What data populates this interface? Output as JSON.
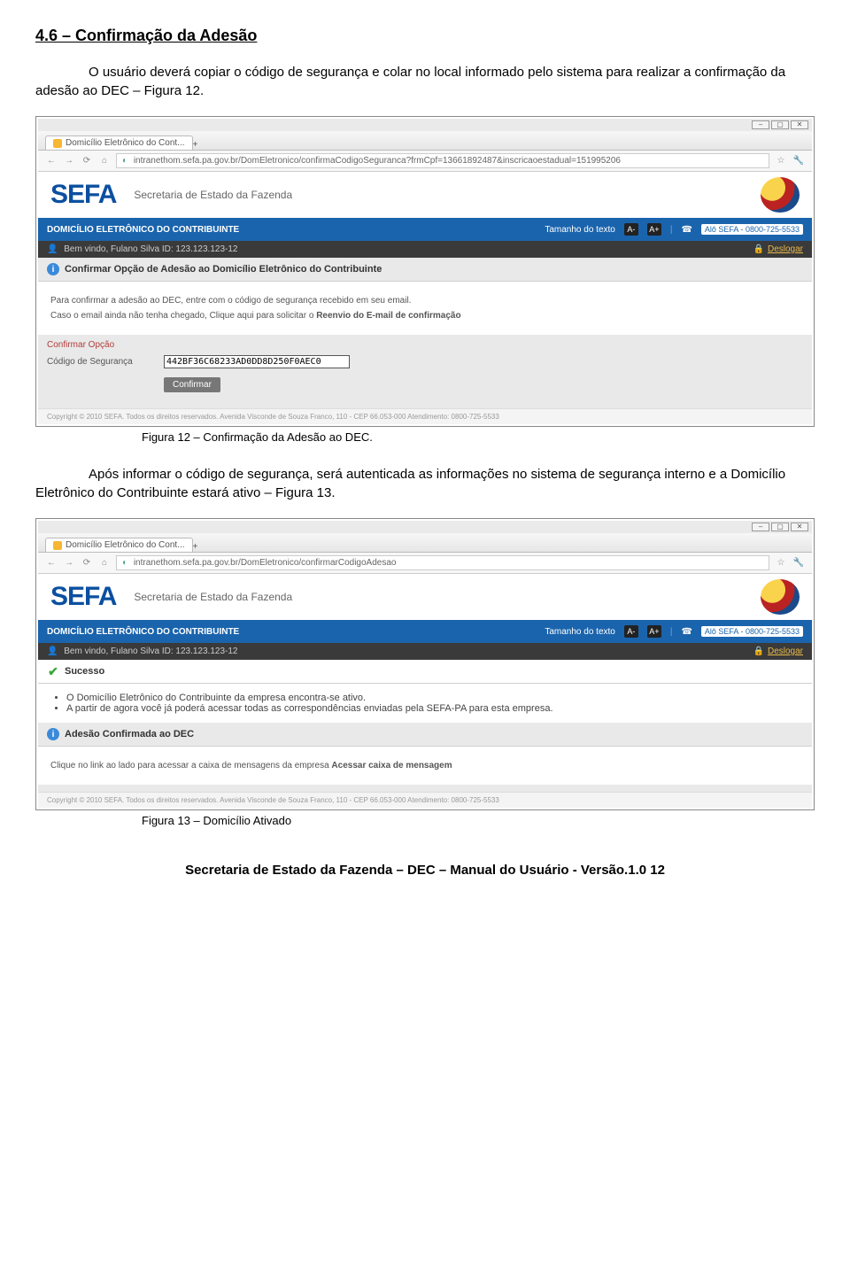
{
  "doc": {
    "heading": "4.6 – Confirmação da Adesão",
    "para1": "O usuário deverá copiar o código de segurança e colar no local informado pelo sistema para realizar a confirmação da adesão ao DEC – Figura 12.",
    "caption12": "Figura 12 – Confirmação da Adesão ao DEC.",
    "para2": "Após informar o código de segurança, será autenticada as informações no sistema de segurança interno e a Domicílio Eletrônico do Contribuinte estará ativo –   Figura 13.",
    "caption13": "Figura 13 – Domicílio Ativado",
    "footer": "Secretaria de Estado da Fazenda – DEC – Manual do Usuário  - Versão.1.0",
    "page": "12"
  },
  "shot1": {
    "tab": "Domicílio Eletrônico do Cont...",
    "url": "intranethom.sefa.pa.gov.br/DomEletronico/confirmaCodigoSeguranca?frmCpf=13661892487&inscricaoestadual=151995206",
    "logo": "SEFA",
    "sub": "Secretaria de Estado da Fazenda",
    "bluebar": "DOMICÍLIO ELETRÔNICO DO CONTRIBUINTE",
    "textsize": "Tamanho do texto",
    "alo": "Alô SEFA - 0800-725-5533",
    "welcome": "Bem vindo, Fulano Silva     ID: 123.123.123-12",
    "logout": "Deslogar",
    "panel_title": "Confirmar Opção de Adesão ao Domicílio Eletrônico do Contribuinte",
    "body1": "Para confirmar a adesão ao DEC, entre com o código de segurança recebido em seu email.",
    "body2a": "Caso o email ainda não tenha chegado, Clique aqui para solicitar o ",
    "body2b": "Reenvio do E-mail de confirmação",
    "fieldset": "Confirmar Opção",
    "field_label": "Código de Segurança",
    "field_value": "442BF36C68233AD0DD8D250F0AEC0",
    "confirm": "Confirmar",
    "copyright": "Copyright © 2010 SEFA. Todos os direitos reservados. Avenida Visconde de Souza Franco, 110 - CEP 66.053-000 Atendimento: 0800-725-5533"
  },
  "shot2": {
    "tab": "Domicílio Eletrônico do Cont...",
    "url": "intranethom.sefa.pa.gov.br/DomEletronico/confirmarCodigoAdesao",
    "logo": "SEFA",
    "sub": "Secretaria de Estado da Fazenda",
    "bluebar": "DOMICÍLIO ELETRÔNICO DO CONTRIBUINTE",
    "textsize": "Tamanho do texto",
    "alo": "Alô SEFA - 0800-725-5533",
    "welcome": "Bem vindo, Fulano Silva     ID: 123.123.123-12",
    "logout": "Deslogar",
    "success": "Sucesso",
    "bullet1": "O Domicílio Eletrônico do Contribuinte da empresa encontra-se ativo.",
    "bullet2": "A partir de agora você já poderá acessar todas as correspondências enviadas pela SEFA-PA para esta empresa.",
    "panel_title": "Adesão Confirmada ao DEC",
    "body3a": "Clique no link ao lado para acessar a caixa de mensagens da empresa ",
    "body3b": "Acessar caixa de mensagem",
    "copyright": "Copyright © 2010 SEFA. Todos os direitos reservados. Avenida Visconde de Souza Franco, 110 - CEP 66.053-000 Atendimento: 0800-725-5533"
  }
}
